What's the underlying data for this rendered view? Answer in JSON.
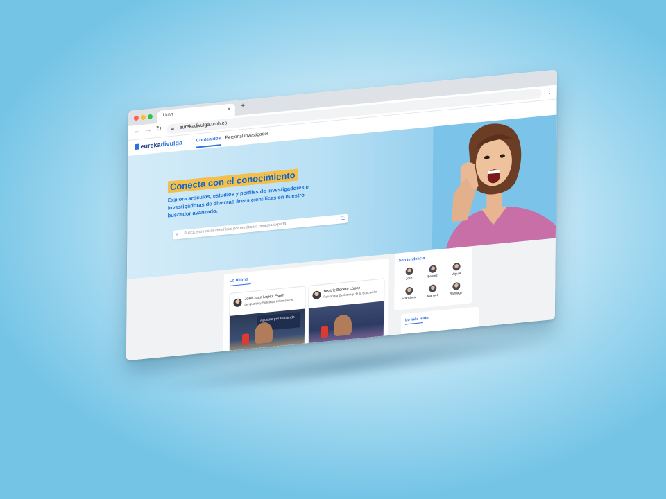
{
  "browser": {
    "tab_title": "Umh",
    "tab_close": "×",
    "new_tab": "+",
    "url": "eurekadivulga.umh.es",
    "menu_dots": "⋮"
  },
  "site": {
    "logo_part1": "eureka",
    "logo_part2": "divulga",
    "nav": [
      "Contenidos",
      "Personal investigador"
    ]
  },
  "hero": {
    "headline": "Conecta con el conocimiento",
    "subtitle": "Explora artículos, estudios y perfiles de investigadores e investigadoras de diversas áreas científicas en nuestro buscador avanzado.",
    "search_placeholder": "Busca entrevistas científicas por temática o persona experta"
  },
  "latest": {
    "title": "Lo último",
    "posts": [
      {
        "name": "José Juan López Espín",
        "dept": "Lenguajes y Sistemas Informáticos",
        "banner": "Apuesta por Haciendo"
      },
      {
        "name": "Beatriz Bonete López",
        "dept": "Psicología Evolutiva y de la Educación",
        "banner": ""
      }
    ]
  },
  "trending": {
    "title": "Son tendencia",
    "people": [
      "José",
      "Beatriz",
      "Miguel",
      "Francisco",
      "Manuel",
      "Santiago"
    ]
  },
  "most_read": {
    "title": "Lo más leído"
  },
  "colors": {
    "accent": "#2e6fe0",
    "headline_bg": "#f3c04c"
  }
}
